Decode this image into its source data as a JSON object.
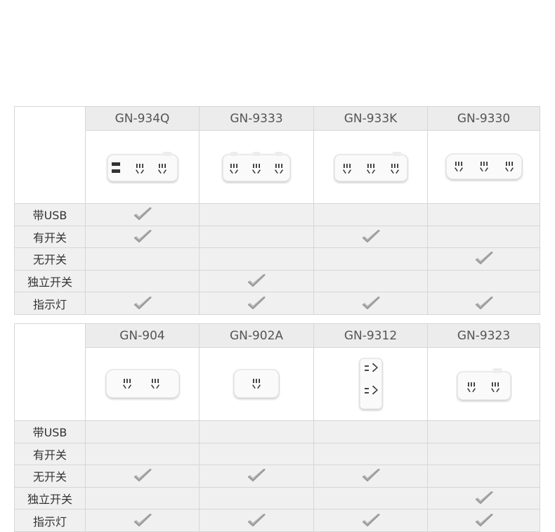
{
  "feature_labels": [
    "带USB",
    "有开关",
    "无开关",
    "独立开关",
    "指示灯"
  ],
  "tables": [
    {
      "products": [
        {
          "model": "GN-934Q",
          "shape": "usb3",
          "features": [
            true,
            true,
            false,
            false,
            true
          ]
        },
        {
          "model": "GN-9333",
          "shape": "switch3",
          "features": [
            false,
            false,
            false,
            true,
            true
          ]
        },
        {
          "model": "GN-933K",
          "shape": "switch3wide",
          "features": [
            false,
            true,
            false,
            false,
            true
          ]
        },
        {
          "model": "GN-9330",
          "shape": "plain3",
          "features": [
            false,
            false,
            true,
            false,
            true
          ]
        }
      ]
    },
    {
      "products": [
        {
          "model": "GN-904",
          "shape": "plain2",
          "features": [
            false,
            false,
            true,
            false,
            true
          ]
        },
        {
          "model": "GN-902A",
          "shape": "plain1",
          "features": [
            false,
            false,
            true,
            false,
            true
          ]
        },
        {
          "model": "GN-9312",
          "shape": "vertical2",
          "features": [
            false,
            false,
            true,
            false,
            true
          ]
        },
        {
          "model": "GN-9323",
          "shape": "switch2",
          "features": [
            false,
            false,
            false,
            true,
            true
          ]
        }
      ]
    }
  ]
}
